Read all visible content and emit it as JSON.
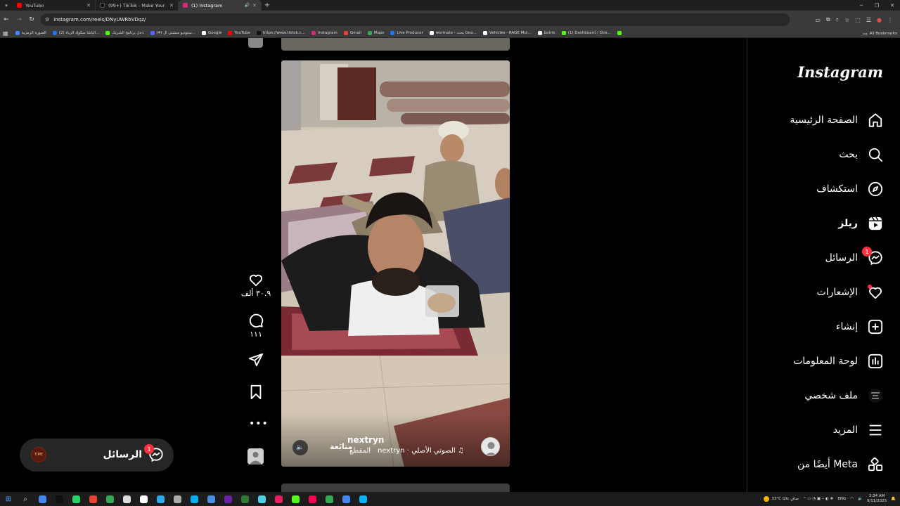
{
  "browser": {
    "tabs": [
      {
        "title": "YouTube",
        "favicon_color": "#ff0000",
        "active": false
      },
      {
        "title": "(99+) TikTok - Make Your Day",
        "favicon_color": "#111111",
        "active": false
      },
      {
        "title": "(1) Instagram",
        "favicon_color": "#d62976",
        "active": true
      }
    ],
    "url": "instagram.com/reels/DNyUWRbVDqz/",
    "bookmarks": [
      {
        "label": "الصورة الرمزية",
        "color": "#4285f4"
      },
      {
        "label": "(2) الباشا سكواد الرياء...",
        "color": "#1877f2"
      },
      {
        "label": "ذخل برنامج الشريك",
        "color": "#53fc18"
      },
      {
        "label": "(4) ستوديو منشئي ال...",
        "color": "#5865f2"
      },
      {
        "label": "Google",
        "color": "#ffffff"
      },
      {
        "label": "YouTube",
        "color": "#ff0000"
      },
      {
        "label": "https://www.tiktok.c...",
        "color": "#111111"
      },
      {
        "label": "Instagram",
        "color": "#d62976"
      },
      {
        "label": "Gmail",
        "color": "#ea4335"
      },
      {
        "label": "Maps",
        "color": "#34a853"
      },
      {
        "label": "Live Producer",
        "color": "#1877f2"
      },
      {
        "label": "wormate - بحث Goo...",
        "color": "#ffffff"
      },
      {
        "label": "Vehicles - RAGE Mul...",
        "color": "#ffffff"
      },
      {
        "label": "botrix",
        "color": "#ffffff"
      },
      {
        "label": "(1) Dashboard / Stre...",
        "color": "#53fc18"
      }
    ],
    "all_bookmarks": "All Bookmarks"
  },
  "sidebar": {
    "logo": "Instagram",
    "items": [
      {
        "label": "الصفحة الرئيسية",
        "icon": "home-icon"
      },
      {
        "label": "بحث",
        "icon": "search-icon"
      },
      {
        "label": "استكشاف",
        "icon": "explore-icon"
      },
      {
        "label": "ريلز",
        "icon": "reels-icon"
      },
      {
        "label": "الرسائل",
        "icon": "messenger-icon",
        "badge": "1"
      },
      {
        "label": "الإشعارات",
        "icon": "heart-icon",
        "dot": true
      },
      {
        "label": "إنشاء",
        "icon": "create-icon"
      },
      {
        "label": "لوحة المعلومات",
        "icon": "dashboard-icon"
      },
      {
        "label": "ملف شخصي",
        "icon": "profile-avatar"
      },
      {
        "label": "المزيد",
        "icon": "menu-icon"
      },
      {
        "label": "أيضًا من Meta",
        "icon": "meta-apps-icon"
      }
    ]
  },
  "reel": {
    "username": "nextryn",
    "follow": "متابَعة",
    "caption": "المقطع",
    "audio": "nextryn · الصوتي الأصلي",
    "likes": "٣٠.٩ ألف",
    "comments": "١١١"
  },
  "messages_pill": {
    "label": "الرسائل",
    "badge": "1"
  },
  "taskbar": {
    "weather": "33°C صافٍ غالبًا",
    "lang": "ENG",
    "time": "3:34 AM",
    "date": "9/11/2025",
    "apps": [
      "#4285f4",
      "#111111",
      "#25d366",
      "#ea4335",
      "#34a853",
      "#dddddd",
      "#ffffff",
      "#2aabee",
      "#aaaaaa",
      "#00aff0",
      "#4a90e2",
      "#6b21a8",
      "#2e7d32",
      "#4dd0e1",
      "#e91e63",
      "#53fc18",
      "#ff0050",
      "#34a853",
      "#4285f4",
      "#00b4ff"
    ]
  }
}
